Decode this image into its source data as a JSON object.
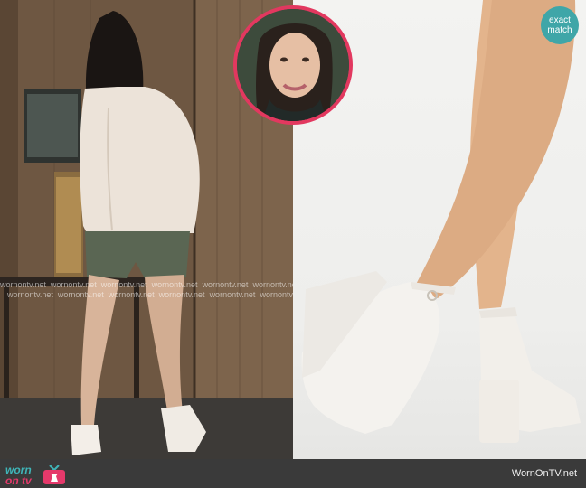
{
  "badge": {
    "line1": "exact",
    "line2": "match"
  },
  "watermark": {
    "text": "wornontv.net"
  },
  "footer": {
    "logo_word1": "worn",
    "logo_word2": "on tv",
    "credit": "WornOnTV.net"
  },
  "colors": {
    "accent_pink": "#e2385f",
    "accent_teal": "#3fa6a8",
    "footer_bg": "#3a3a3a"
  },
  "icons": {
    "logo_tv": "tv-icon"
  }
}
